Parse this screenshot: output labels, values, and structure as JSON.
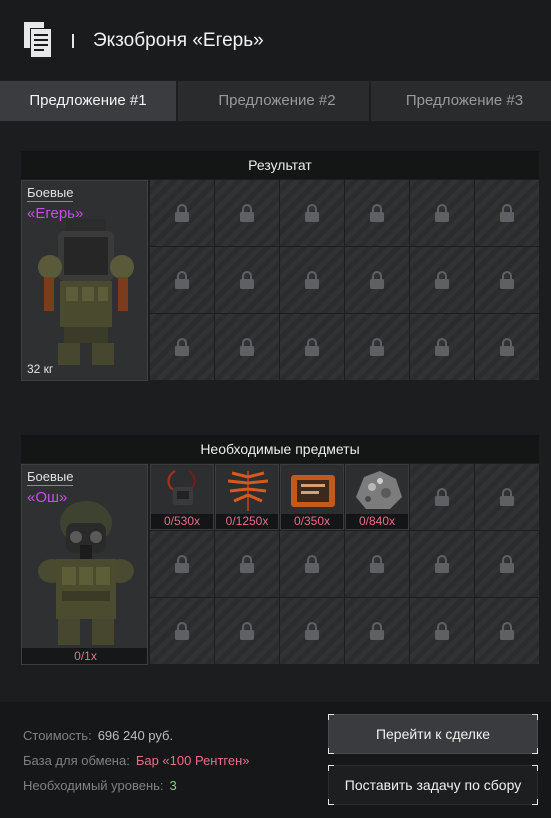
{
  "header": {
    "title": "Экзоброня «Егерь»",
    "icon": "documents-icon"
  },
  "tabs": [
    {
      "label": "Предложение #1",
      "active": true
    },
    {
      "label": "Предложение #2",
      "active": false
    },
    {
      "label": "Предложение #3",
      "active": false
    }
  ],
  "result": {
    "heading": "Результат",
    "item": {
      "category": "Боевые",
      "name": "«Егерь»",
      "weight": "32 кг",
      "image": "exoskeleton-armor-image"
    }
  },
  "required": {
    "heading": "Необходимые предметы",
    "item": {
      "category": "Боевые",
      "name": "«Ош»",
      "count": "0/1x",
      "image": "combat-armor-gasmask-image"
    },
    "resources": [
      {
        "qty": "0/530x",
        "image": "wired-device-image"
      },
      {
        "qty": "0/1250x",
        "image": "orange-fern-image"
      },
      {
        "qty": "0/350x",
        "image": "orange-box-image"
      },
      {
        "qty": "0/840x",
        "image": "grey-ore-image"
      }
    ]
  },
  "footer": {
    "cost_label": "Стоимость:",
    "cost_value": "696 240 руб.",
    "base_label": "База для обмена:",
    "base_value": "Бар «100 Рентген»",
    "level_label": "Необходимый уровень:",
    "level_value": "3"
  },
  "buttons": {
    "go_to_deal": "Перейти к сделке",
    "set_task": "Поставить задачу по сбору"
  },
  "colors": {
    "accent_name": "#c84fe8",
    "missing_qty": "#e4708a",
    "level_ok": "#7fd27f"
  }
}
